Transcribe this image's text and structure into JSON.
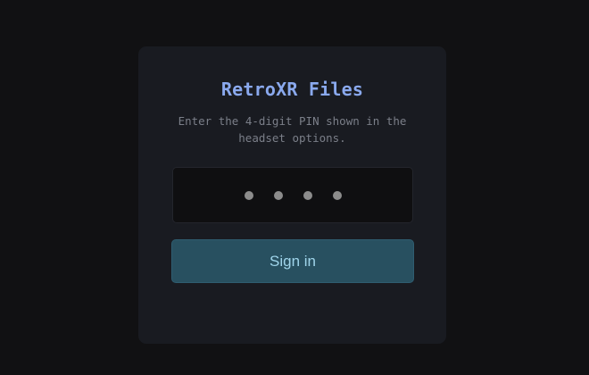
{
  "login": {
    "title": "RetroXR Files",
    "subtitle": "Enter the 4-digit PIN shown in the headset options.",
    "pin": {
      "digits_entered": 4,
      "digits_total": 4,
      "masked_value": "••••"
    },
    "submit_label": "Sign in"
  },
  "colors": {
    "background": "#111113",
    "card": "#191b21",
    "title": "#8aa9ee",
    "button_bg": "#285060",
    "button_text": "#9fd4ea"
  }
}
